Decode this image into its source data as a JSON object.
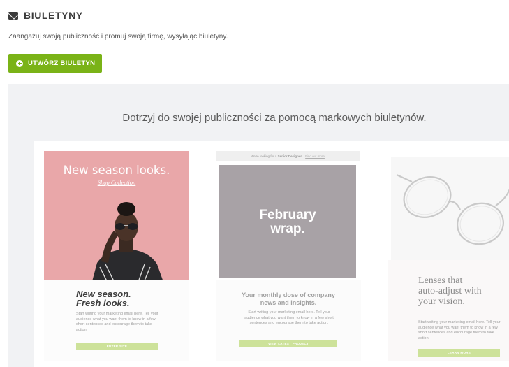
{
  "header": {
    "icon": "envelope-icon",
    "title": "BIULETYNY",
    "subtitle": "Zaangażuj swoją publiczność i promuj swoją firmę, wysyłając biuletyny.",
    "create_button": {
      "icon": "plus-circle-icon",
      "label": "UTWÓRZ BIULETYN",
      "color": "#7ab317"
    }
  },
  "promo": {
    "title": "Dotrzyj do swojej publiczności za pomocą markowych biuletynów.",
    "templates": [
      {
        "hero_title": "New season looks.",
        "hero_link": "Shop Collection",
        "heading_line1": "New season.",
        "heading_line2": "Fresh looks.",
        "body": "Start writing your marketing email here. Tell your audience what you want them to know in a few short sentences and encourage them to take action.",
        "cta": "ENTER SITE",
        "hero_color": "#e9a7a9"
      },
      {
        "top_text": "We're looking for a",
        "top_bold": "Senior Designer.",
        "top_link": "Find out more",
        "hero_line1": "February",
        "hero_line2": "wrap.",
        "heading_line1": "Your monthly dose of company",
        "heading_line2": "news and insights.",
        "body": "Start writing your marketing email here. Tell your audience what you want them to know in a few short sentences and encourage them to take action.",
        "cta": "VIEW LATEST PROJECT",
        "hero_color": "#a8a2a6"
      },
      {
        "heading_line1": "Lenses that",
        "heading_line2": "auto-adjust with",
        "heading_line3": "your vision.",
        "body": "Start writing your marketing email here. Tell your audience what you want them to know in a few short sentences and encourage them to take action.",
        "cta": "LEARN MORE"
      }
    ]
  }
}
